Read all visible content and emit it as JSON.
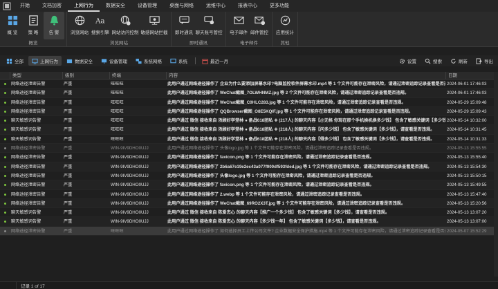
{
  "menu": {
    "items": [
      {
        "label": "开始"
      },
      {
        "label": "文档加密"
      },
      {
        "label": "上网行为",
        "active": true
      },
      {
        "label": "数据安全"
      },
      {
        "label": "设备管理"
      },
      {
        "label": "桌面与网络"
      },
      {
        "label": "运维中心"
      },
      {
        "label": "报表中心"
      },
      {
        "label": "更多功能"
      }
    ]
  },
  "ribbon": {
    "groups": [
      {
        "label": "概览",
        "buttons": [
          {
            "label": "概 览",
            "icon": "grid-icon"
          },
          {
            "label": "策 略",
            "icon": "policy-icon"
          },
          {
            "label": "告 警",
            "icon": "bell-icon",
            "selected": true
          }
        ]
      },
      {
        "label": "浏览网站",
        "buttons": [
          {
            "label": "浏览网站",
            "icon": "globe-icon"
          },
          {
            "label": "搜索引擎",
            "icon": "search-engine-icon"
          },
          {
            "label": "网站访问控制",
            "icon": "globe-control-icon"
          },
          {
            "label": "敏感网站拦截",
            "icon": "monitor-block-icon"
          }
        ]
      },
      {
        "label": "即时通讯",
        "buttons": [
          {
            "label": "即时通讯",
            "icon": "chat-icon"
          },
          {
            "label": "聊天账号管控",
            "icon": "chat-account-icon"
          }
        ]
      },
      {
        "label": "电子邮件",
        "buttons": [
          {
            "label": "电子邮件",
            "icon": "mail-icon"
          },
          {
            "label": "邮件管控",
            "icon": "mail-control-icon"
          }
        ]
      },
      {
        "label": "其他",
        "buttons": [
          {
            "label": "应用统计",
            "icon": "stats-icon"
          }
        ]
      }
    ]
  },
  "toolbar": {
    "filters": [
      {
        "label": "全部",
        "icon": "all-icon"
      },
      {
        "label": "上网行为",
        "icon": "web-behavior-icon",
        "selected": true
      },
      {
        "label": "数据安全",
        "icon": "data-security-icon"
      },
      {
        "label": "设备管理",
        "icon": "device-icon"
      },
      {
        "label": "系统网络",
        "icon": "system-network-icon"
      },
      {
        "label": "系统",
        "icon": "system-icon"
      }
    ],
    "period": {
      "label": "最近一月",
      "icon": "calendar-icon"
    },
    "actions": [
      {
        "label": "设置",
        "icon": "gear-icon"
      },
      {
        "label": "搜索",
        "icon": "search-icon"
      },
      {
        "label": "刷新",
        "icon": "refresh-icon"
      },
      {
        "label": "导出",
        "icon": "export-icon"
      }
    ]
  },
  "table": {
    "columns": [
      "类型",
      "级别",
      "终端",
      "内容",
      "日期"
    ],
    "rows": [
      {
        "type": "网络途径泄密告警",
        "severity": "严重",
        "terminal": "旺旺旺",
        "content": "此用户通过网络途径操作了 企业为什么要添加屏幕水印?电脑监控软件屏幕水印.mp4 等 1 个文件可能存在泄密风险，请通过泄密追踪记录查看是否违规。",
        "date": "2024-06-01 17:46:03",
        "dot": "#7ec63d",
        "bold": true,
        "dim": false
      },
      {
        "type": "网络途径泄密告警",
        "severity": "严重",
        "terminal": "旺旺旺",
        "content": "此用户通过网络途径操作了 WeChat截图_7OLWHNMZ.jpg 等 2 个文件可能存在泄密风险，请通过泄密追踪记录查看是否违规。",
        "date": "2024-06-01 17:46:03",
        "dot": "#7ec63d",
        "bold": true,
        "dim": false
      },
      {
        "type": "网络途径泄密告警",
        "severity": "严重",
        "terminal": "旺旺旺",
        "content": "此用户通过网络途径操作了 WeChat截图_C0HLC283.jpg 等 1 个文件可能存在泄密风险，请通过泄密追踪记录查看是否违规。",
        "date": "2024-05-29 15:09:48",
        "dot": "#7ec63d",
        "bold": true,
        "dim": false
      },
      {
        "type": "网络途径泄密告警",
        "severity": "严重",
        "terminal": "旺旺旺",
        "content": "此用户通过网络途径操作了 QQBrowser截图_O8E5KQIF.jpg 等 1 个文件可能存在泄密风险，请通过泄密追踪记录查看是否违规。",
        "date": "2024-05-29 15:09:43",
        "dot": "#7ec63d",
        "bold": true,
        "dim": false
      },
      {
        "type": "聊天敏感词告警",
        "severity": "严重",
        "terminal": "旺旺旺",
        "content": "此用户通过 微信 接收来自 汤顾好学堂林 ● 备战618团私 ✚ (217人) 的聊天内容【@无格 你现在那个手机换机换多少钱】 包含了敏感关键词【多少钱】，请查看是否违规。",
        "date": "2024-05-14 10:32:00",
        "dot": "#7ec63d",
        "bold": true,
        "dim": false
      },
      {
        "type": "聊天敏感词告警",
        "severity": "严重",
        "terminal": "旺旺旺",
        "content": "此用户通过 微信 接收来自 汤顾好学堂林 ● 备战618团私 ✚ (218人) 的聊天内容【问多少钱】 包含了敏感关键词【多少钱】，请查看是否违规。",
        "date": "2024-05-14 10:31:45",
        "dot": "#7ec63d",
        "bold": true,
        "dim": false
      },
      {
        "type": "聊天敏感词告警",
        "severity": "严重",
        "terminal": "旺旺旺",
        "content": "此用户通过 微信 接收来自 汤顾好学堂林 ● 备战618团私 ✚ (218人) 的聊天内容【得多少钱】 包含了敏感关键词【多少钱】，请查看是否违规。",
        "date": "2024-05-14 10:31:33",
        "dot": "#7ec63d",
        "bold": true,
        "dim": false
      },
      {
        "type": "网络途径泄密告警",
        "severity": "严重",
        "terminal": "WIN-9IV9DHO0UJJ",
        "content": "此用户通过网络途径操作了 头像logo.jpg 等 1 个文件可能存在泄密风险，请通过泄密追踪记录查看是否违规。",
        "date": "2024-05-13 15:55:55",
        "dot": "#8a8a8a",
        "bold": false,
        "dim": true
      },
      {
        "type": "网络途径泄密告警",
        "severity": "严重",
        "terminal": "WIN-9IV9DHO0UJJ",
        "content": "此用户通过网络途径操作了 favicon.png 等 1 个文件可能存在泄密风险，请通过泄密追踪记录查看是否违规。",
        "date": "2024-05-13 15:55:40",
        "dot": "#7ec63d",
        "bold": true,
        "dim": false
      },
      {
        "type": "网络途径泄密告警",
        "severity": "严重",
        "terminal": "WIN-9IV9DHO0UJJ",
        "content": "此用户通过网络途径操作了 2b6a67e19e2ec43a077f900df593fded.jpg 等 1 个文件可能存在泄密风险，请通过泄密追踪记录查看是否违规。",
        "date": "2024-05-13 15:54:30",
        "dot": "#7ec63d",
        "bold": true,
        "dim": false
      },
      {
        "type": "网络途径泄密告警",
        "severity": "严重",
        "terminal": "WIN-9IV9DHO0UJJ",
        "content": "此用户通过网络途径操作了 头像logo.jpg 等 1 个文件可能存在泄密风险，请通过泄密追踪记录查看是否违规。",
        "date": "2024-05-13 15:50:15",
        "dot": "#7ec63d",
        "bold": true,
        "dim": false
      },
      {
        "type": "网络途径泄密告警",
        "severity": "严重",
        "terminal": "WIN-9IV9DHO0UJJ",
        "content": "此用户通过网络途径操作了 favicon.png 等 1 个文件可能存在泄密风险，请通过泄密追踪记录查看是否违规。",
        "date": "2024-05-13 15:49:55",
        "dot": "#7ec63d",
        "bold": true,
        "dim": false
      },
      {
        "type": "网络途径泄密告警",
        "severity": "严重",
        "terminal": "WIN-9IV9DHO0UJJ",
        "content": "此用户通过网络途径操作了 2.webp 等 1 个文件可能存在泄密风险，请通过泄密追踪记录查看是否违规。",
        "date": "2024-05-13 15:47:40",
        "dot": "#7ec63d",
        "bold": true,
        "dim": false
      },
      {
        "type": "网络途径泄密告警",
        "severity": "严重",
        "terminal": "WIN-9IV9DHO0UJJ",
        "content": "此用户通过网络途径操作了 WeChat截图_69RO2X3T.jpg 等 1 个文件可能存在泄密风险，请通过泄密追踪记录查看是否违规。",
        "date": "2024-05-13 15:20:56",
        "dot": "#7ec63d",
        "bold": true,
        "dim": false
      },
      {
        "type": "聊天敏感词告警",
        "severity": "严重",
        "terminal": "WIN-9IV9DHO0UJJ",
        "content": "此用户通过 微信 接收来自 陈爱杰心 的聊天内容【推广一个多少钱】 包含了敏感关键词【多少钱】，请查看是否违规。",
        "date": "2024-05-13 13:07:20",
        "dot": "#7ec63d",
        "bold": true,
        "dim": false
      },
      {
        "type": "聊天敏感词告警",
        "severity": "严重",
        "terminal": "WIN-9IV9DHO0UJJ",
        "content": "此用户通过 微信 接收来自 陈爱杰心 的聊天内容【多少钱一年】 包含了敏感关键词【多少钱】，请查看是否违规。",
        "date": "2024-05-13 13:07:00",
        "dot": "#7ec63d",
        "bold": true,
        "dim": false
      },
      {
        "type": "网络途径泄密告警",
        "severity": "严重",
        "terminal": "旺旺旺",
        "content": "此用户通过网络途径操作了 如何选择员工上传公司文件? 企业数据安全保护措施.mp4 等 1 个文件可能存在泄密风险，请通过泄密追踪记录查看是否违规。",
        "date": "2024-05-07 15:52:29",
        "dot": "#8a8a8a",
        "bold": false,
        "dim": true
      }
    ]
  },
  "status": {
    "records": "记录 1 of 17"
  }
}
